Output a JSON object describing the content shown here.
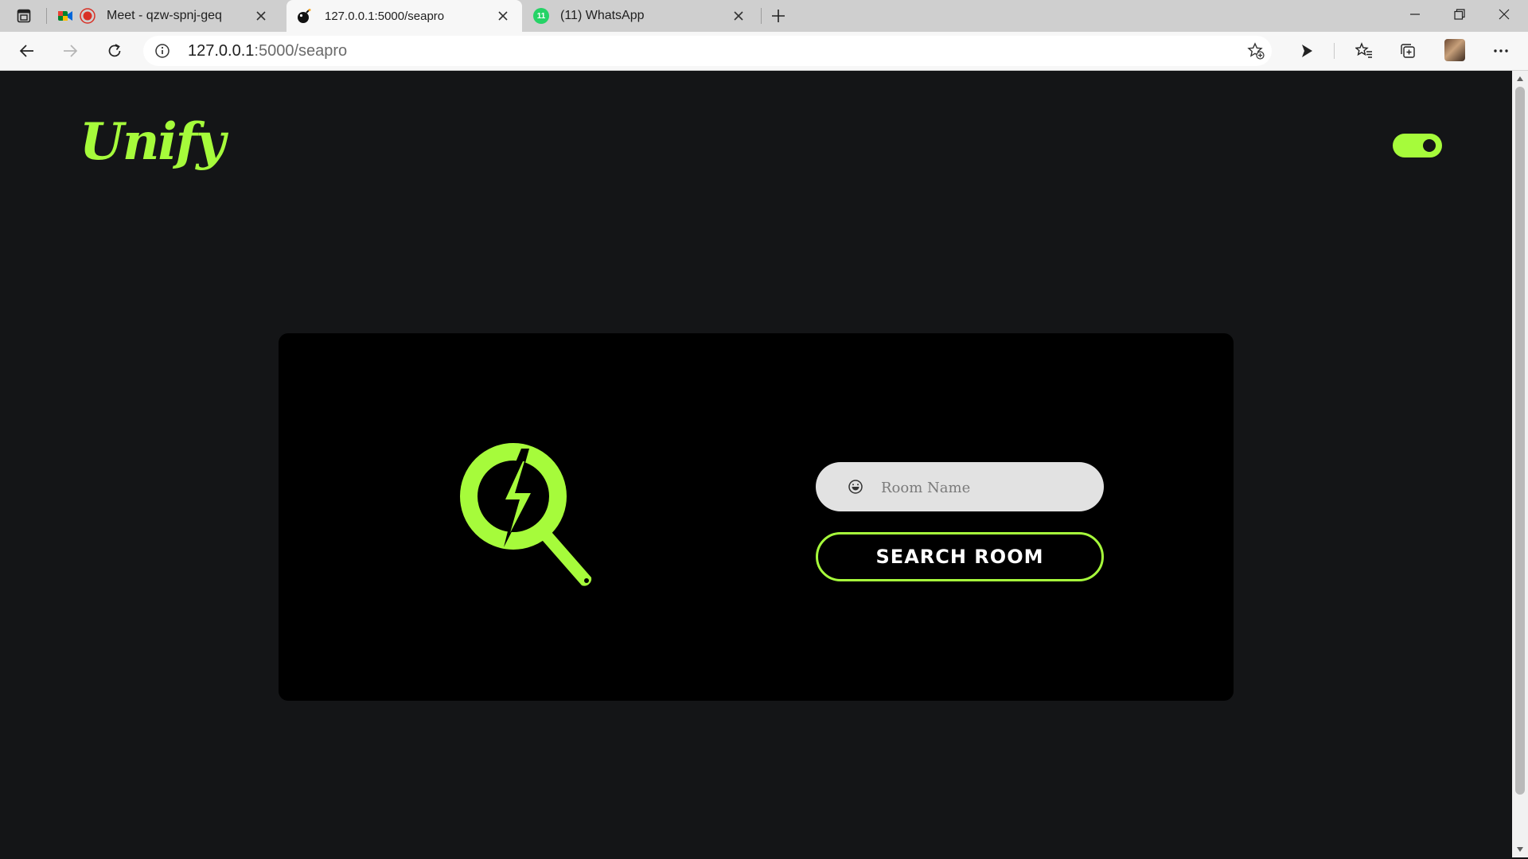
{
  "browser": {
    "tabs": [
      {
        "title": "Meet - qzw-spnj-geq",
        "icon": "google-meet-icon",
        "recording_indicator": "record-icon"
      },
      {
        "title": "127.0.0.1:5000/seapro",
        "icon": "bomb-favicon",
        "active": true
      },
      {
        "title": "(11) WhatsApp",
        "icon": "whatsapp-icon",
        "badge": "11"
      }
    ],
    "address": {
      "host": "127.0.0.1",
      "path": ":5000/seapro"
    },
    "colors": {
      "tab_strip": "#cfcfcf",
      "toolbar": "#f7f7f7"
    }
  },
  "page": {
    "logo": "Unify",
    "theme_toggle": {
      "on": true
    },
    "room_input": {
      "placeholder": "Room Name",
      "icon": "smiley-icon"
    },
    "search_button": "Search Room",
    "graphic_icon": "lightning-magnifier-icon",
    "colors": {
      "background": "#141517",
      "card": "#000000",
      "accent": "#a6fb3b"
    }
  }
}
